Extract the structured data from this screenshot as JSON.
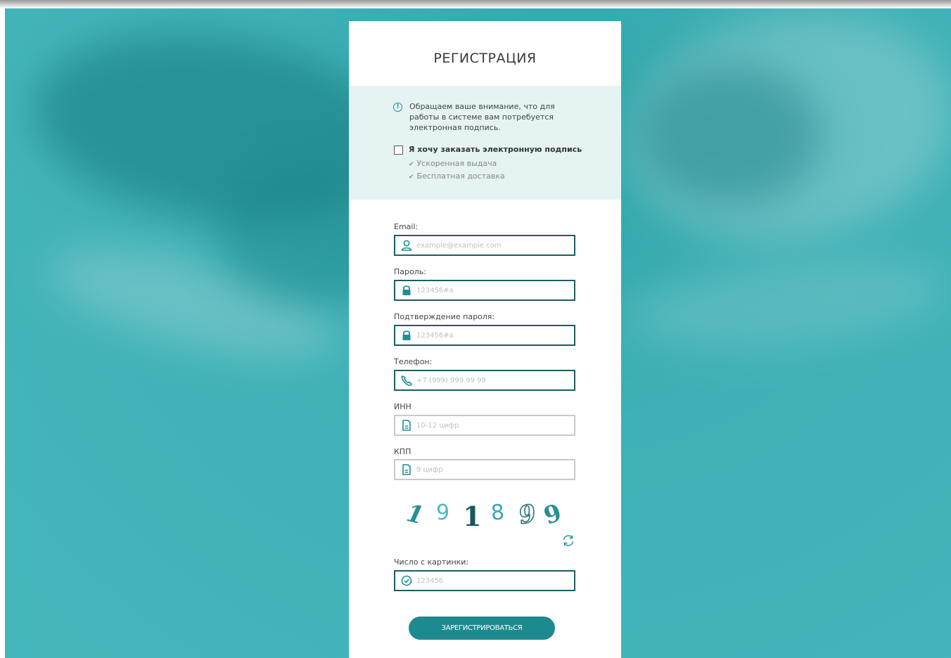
{
  "page": {
    "title": "РЕГИСТРАЦИЯ"
  },
  "notice": {
    "icon": "info-circle-icon",
    "text": "Обращаем ваше внимание, что для работы в системе вам потребуется электронная подпись.",
    "order_label": "Я хочу заказать электронную подпись",
    "order_checked": false,
    "benefits": [
      "Ускоренная выдача",
      "Бесплатная доставка"
    ]
  },
  "form": {
    "email": {
      "label": "Email:",
      "placeholder": "example@example.com",
      "value": "",
      "icon": "user-icon"
    },
    "password": {
      "label": "Пароль:",
      "placeholder": "123456#a",
      "value": "",
      "icon": "lock-icon"
    },
    "password_confirm": {
      "label": "Подтверждение пароля:",
      "placeholder": "123456#a",
      "value": "",
      "icon": "lock-icon"
    },
    "phone": {
      "label": "Телефон:",
      "placeholder": "+7 (999) 999 99 99",
      "value": "",
      "icon": "phone-icon"
    },
    "inn": {
      "label": "ИНН",
      "placeholder": "10-12 цифр",
      "value": "",
      "icon": "document-icon"
    },
    "kpp": {
      "label": "КПП",
      "placeholder": "9 цифр",
      "value": "",
      "icon": "document-icon"
    },
    "captcha_input": {
      "label": "Число с картинки:",
      "placeholder": "123456",
      "value": "",
      "icon": "check-circle-icon"
    }
  },
  "captcha": {
    "digits": [
      "1",
      "9",
      "1",
      "8",
      "9",
      "9"
    ]
  },
  "actions": {
    "register_label": "ЗАРЕГИСТРИРОВАТЬСЯ"
  },
  "colors": {
    "accent": "#1d8a90",
    "field_border": "#1d5e61",
    "background": "#3fb1b6",
    "notice_bg": "#e6f3f3"
  }
}
